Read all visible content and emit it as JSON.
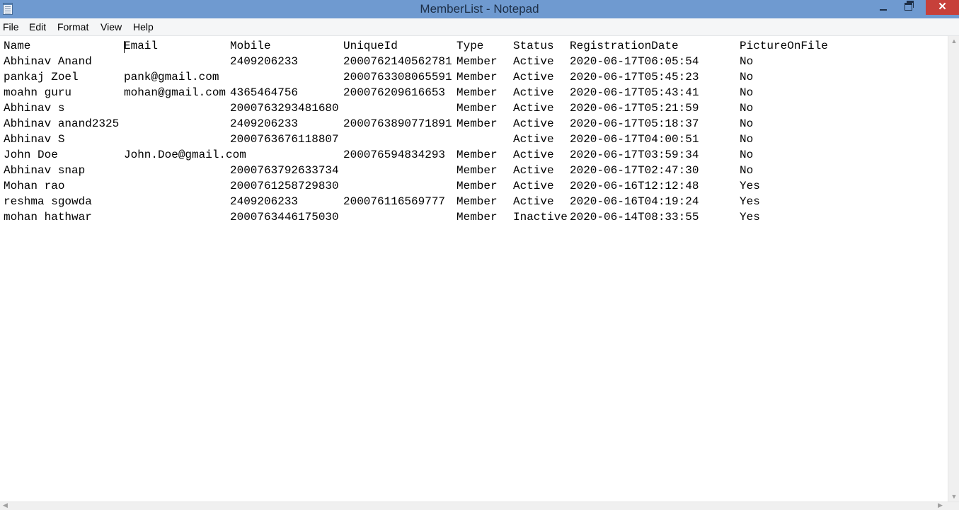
{
  "window": {
    "title": "MemberList - Notepad",
    "icon": "notepad-icon",
    "minimize_glyph": "",
    "close_glyph": "✕"
  },
  "menu": [
    "File",
    "Edit",
    "Format",
    "View",
    "Help"
  ],
  "columns": [
    "Name",
    "Email",
    "Mobile",
    "UniqueId",
    "Type",
    "Status",
    "RegistrationDate",
    "PictureOnFile"
  ],
  "rows": [
    [
      "Abhinav Anand",
      "",
      "2409206233",
      "2000762140562781",
      "Member",
      "Active",
      "2020-06-17T06:05:54",
      "No"
    ],
    [
      "pankaj Zoel",
      "pank@gmail.com",
      "",
      "2000763308065591",
      "Member",
      "Active",
      "2020-06-17T05:45:23",
      "No"
    ],
    [
      "moahn guru",
      "mohan@gmail.com",
      "4365464756",
      "200076209616653",
      "Member",
      "Active",
      "2020-06-17T05:43:41",
      "No"
    ],
    [
      "Abhinav s",
      "",
      "2000763293481680",
      "",
      "Member",
      "Active",
      "2020-06-17T05:21:59",
      "No"
    ],
    [
      "Abhinav anand2325",
      "",
      "2409206233",
      "2000763890771891",
      "Member",
      "Active",
      "2020-06-17T05:18:37",
      "No"
    ],
    [
      "Abhinav S",
      "",
      "2000763676118807",
      "",
      "",
      "Active",
      "2020-06-17T04:00:51",
      "No"
    ],
    [
      "John Doe",
      "John.Doe@gmail.com",
      "",
      "200076594834293",
      "Member",
      "Active",
      "2020-06-17T03:59:34",
      "No"
    ],
    [
      "Abhinav snap",
      "",
      "2000763792633734",
      "",
      "Member",
      "Active",
      "2020-06-17T02:47:30",
      "No"
    ],
    [
      "Mohan rao",
      "",
      "2000761258729830",
      "",
      "Member",
      "Active",
      "2020-06-16T12:12:48",
      "Yes"
    ],
    [
      "reshma sgowda",
      "",
      "2409206233",
      "200076116569777",
      "Member",
      "Active",
      "2020-06-16T04:19:24",
      "Yes"
    ],
    [
      "mohan hathwar",
      "",
      "2000763446175030",
      "",
      "Member",
      "Inactive",
      "2020-06-14T08:33:55",
      "Yes"
    ]
  ],
  "colors": {
    "titlebar": "#6f9ad0",
    "close_button": "#c7403a",
    "text": "#000000"
  }
}
